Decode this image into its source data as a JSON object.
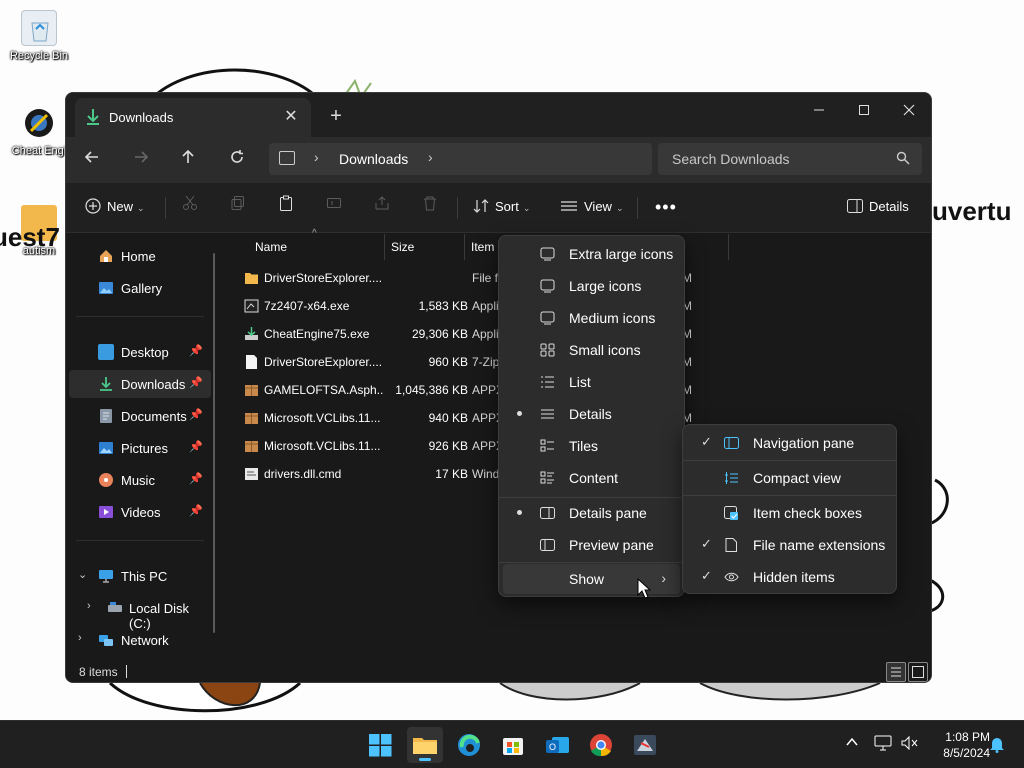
{
  "desktop": {
    "icons": [
      {
        "label": "Recycle Bin"
      },
      {
        "label": "Cheat Engi"
      },
      {
        "label": "autism"
      }
    ],
    "side_text_left": "uest7",
    "side_text_right": "uvertu"
  },
  "window": {
    "tab_title": "Downloads",
    "address_breadcrumb": "Downloads",
    "search_placeholder": "Search Downloads",
    "toolbar": {
      "new_label": "New",
      "sort_label": "Sort",
      "view_label": "View",
      "details_label": "Details"
    },
    "sidebar": {
      "home": "Home",
      "gallery": "Gallery",
      "desktop": "Desktop",
      "downloads": "Downloads",
      "documents": "Documents",
      "pictures": "Pictures",
      "music": "Music",
      "videos": "Videos",
      "this_pc": "This PC",
      "local_disk": "Local Disk (C:)",
      "network": "Network"
    },
    "columns": {
      "name": "Name",
      "size": "Size",
      "type": "Item"
    },
    "files": [
      {
        "name": "DriverStoreExplorer....",
        "size": "",
        "type": "File fo",
        "modified": "M",
        "icon": "folder"
      },
      {
        "name": "7z2407-x64.exe",
        "size": "1,583 KB",
        "type": "Appli",
        "modified": "M",
        "icon": "exe"
      },
      {
        "name": "CheatEngine75.exe",
        "size": "29,306 KB",
        "type": "Appli",
        "modified": "M",
        "icon": "installer"
      },
      {
        "name": "DriverStoreExplorer....",
        "size": "960 KB",
        "type": "7-Zip",
        "modified": "M",
        "icon": "file"
      },
      {
        "name": "GAMELOFTSA.Asph...",
        "size": "1,045,386 KB",
        "type": "APPX",
        "modified": "M",
        "icon": "package"
      },
      {
        "name": "Microsoft.VCLibs.11...",
        "size": "940 KB",
        "type": "APPX",
        "modified": "M",
        "icon": "package"
      },
      {
        "name": "Microsoft.VCLibs.11...",
        "size": "926 KB",
        "type": "APPX",
        "modified": "M",
        "icon": "package"
      },
      {
        "name": "drivers.dll.cmd",
        "size": "17 KB",
        "type": "Wind",
        "modified": "",
        "icon": "script"
      }
    ],
    "status": {
      "item_count": "8 items"
    }
  },
  "view_menu": {
    "items": [
      {
        "label": "Extra large icons",
        "icon": "monitor-icon",
        "selected": false
      },
      {
        "label": "Large icons",
        "icon": "monitor-icon",
        "selected": false
      },
      {
        "label": "Medium icons",
        "icon": "monitor-icon",
        "selected": false
      },
      {
        "label": "Small icons",
        "icon": "grid-icon",
        "selected": false
      },
      {
        "label": "List",
        "icon": "list-icon",
        "selected": false
      },
      {
        "label": "Details",
        "icon": "details-icon",
        "selected": true
      },
      {
        "label": "Tiles",
        "icon": "tiles-icon",
        "selected": false
      },
      {
        "label": "Content",
        "icon": "content-icon",
        "selected": false
      }
    ],
    "panes": [
      {
        "label": "Details pane",
        "selected": true
      },
      {
        "label": "Preview pane",
        "selected": false
      }
    ],
    "show_label": "Show"
  },
  "show_submenu": {
    "items": [
      {
        "label": "Navigation pane",
        "checked": true
      },
      {
        "label": "Compact view",
        "checked": false
      },
      {
        "label": "Item check boxes",
        "checked": false
      },
      {
        "label": "File name extensions",
        "checked": true
      },
      {
        "label": "Hidden items",
        "checked": true
      }
    ]
  },
  "taskbar": {
    "time": "1:08 PM",
    "date": "8/5/2024",
    "accent": "#4cc2ff"
  }
}
